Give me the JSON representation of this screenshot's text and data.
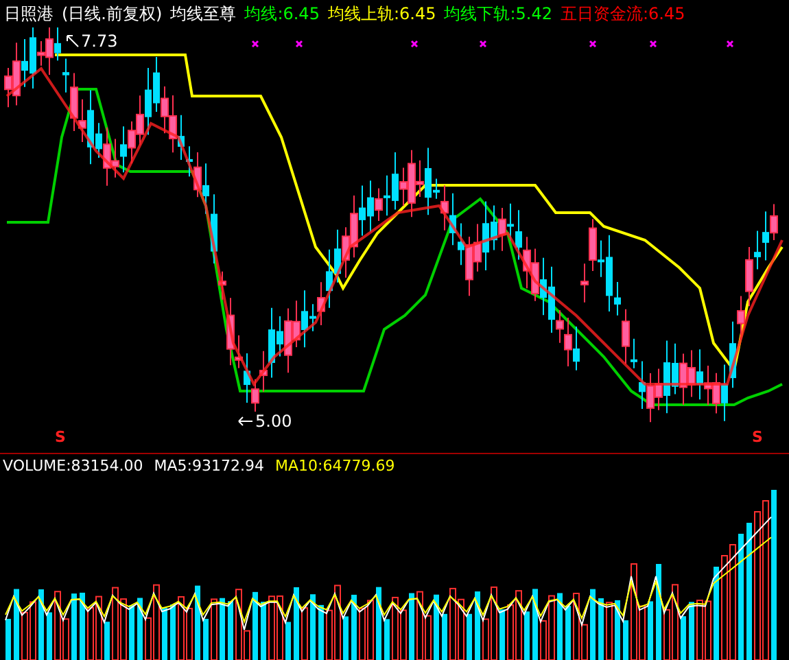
{
  "header": {
    "security": "日照港",
    "period": "(日线.前复权)",
    "indicator": "均线至尊",
    "legend": [
      {
        "label": "均线:6.45",
        "color": "#00ff00"
      },
      {
        "label": "均线上轨:6.45",
        "color": "#ffff00"
      },
      {
        "label": "均线下轨:5.42",
        "color": "#00ff00"
      },
      {
        "label": "五日资金流:6.45",
        "color": "#ff0000"
      }
    ]
  },
  "price_chart": {
    "high_label": "7.73",
    "low_label": "5.00",
    "signals": [
      "S",
      "S"
    ]
  },
  "volume_header": {
    "legend": [
      {
        "label": "VOLUME:83154.00",
        "color": "#ffffff"
      },
      {
        "label": "MA5:93172.94",
        "color": "#ffffff"
      },
      {
        "label": "MA10:64779.69",
        "color": "#ffff00"
      }
    ]
  }
}
